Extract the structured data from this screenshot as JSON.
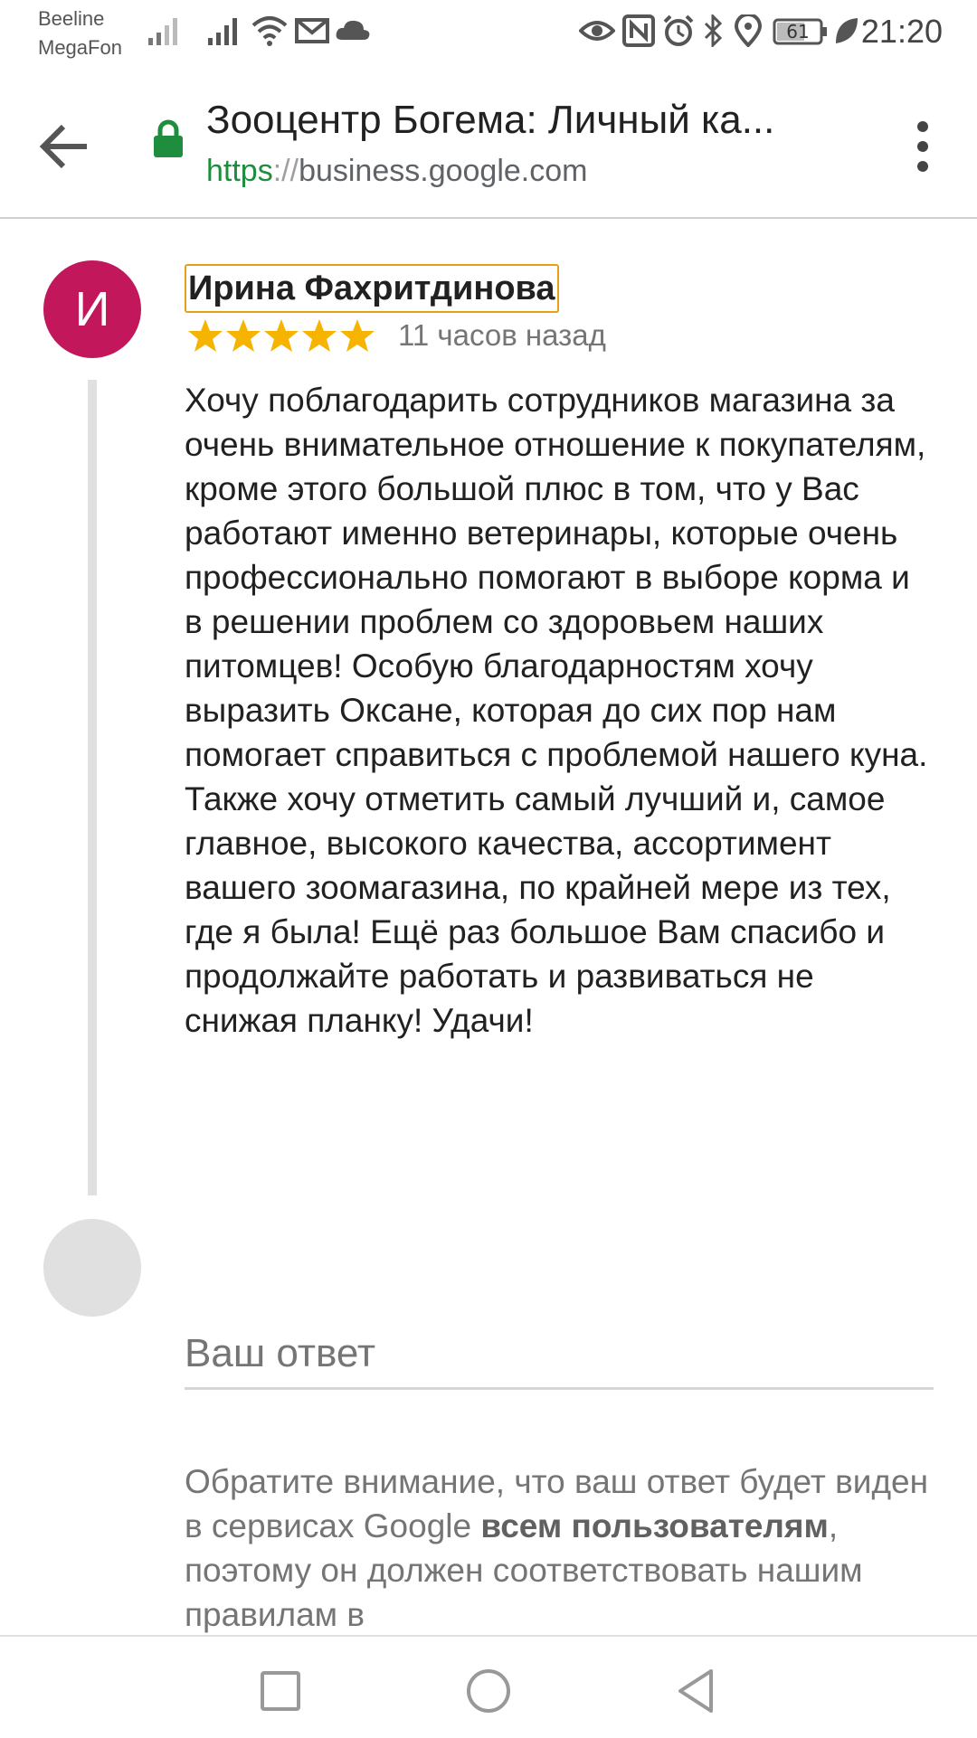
{
  "status_bar": {
    "carrier_1": "Beeline",
    "carrier_2": "MegaFon",
    "battery": "61",
    "time": "21:20",
    "icons": [
      "signal-icon",
      "wifi-icon",
      "mail-icon",
      "cloud-icon",
      "eye-icon",
      "nfc-icon",
      "alarm-icon",
      "bluetooth-icon",
      "location-icon",
      "battery-icon",
      "leaf-icon"
    ]
  },
  "toolbar": {
    "title": "Зооцентр Богема: Личный ка...",
    "url_scheme": "https",
    "url_sep": "://",
    "url_host": "business.google.com"
  },
  "review": {
    "avatar_letter": "И",
    "avatar_color": "#c2185b",
    "author": "Ирина Фахритдинова",
    "rating": 5,
    "star_color": "#f6b400",
    "time": "11 часов назад",
    "text": "Хочу поблагодарить сотрудников магазина за очень внимательное отношение к покупателям, кроме этого большой плюс в том, что у Вас работают именно ветеринары, которые очень профессионально помогают в выборе корма и в решении проблем со здоровьем наших питомцев! Особую благодарностям хочу выразить Оксане, которая до сих пор нам помогает справиться с проблемой нашего куна. Также хочу отметить самый лучший и, самое главное, высокого качества, ассортимент вашего зоомагазина, по крайней мере из тех, где я была! Ещё раз большое Вам спасибо и продолжайте работать и развиваться не снижая планку! Удачи!"
  },
  "reply": {
    "placeholder": "Ваш ответ",
    "notice_part1": "Обратите внимание, что ваш ответ будет виден в сервисах Google ",
    "notice_bold": "всем пользователям",
    "notice_part2": ", поэтому он должен соответствовать нашим правилам в"
  },
  "nav": {
    "buttons": [
      "recents-square-icon",
      "home-circle-icon",
      "back-triangle-icon"
    ]
  }
}
